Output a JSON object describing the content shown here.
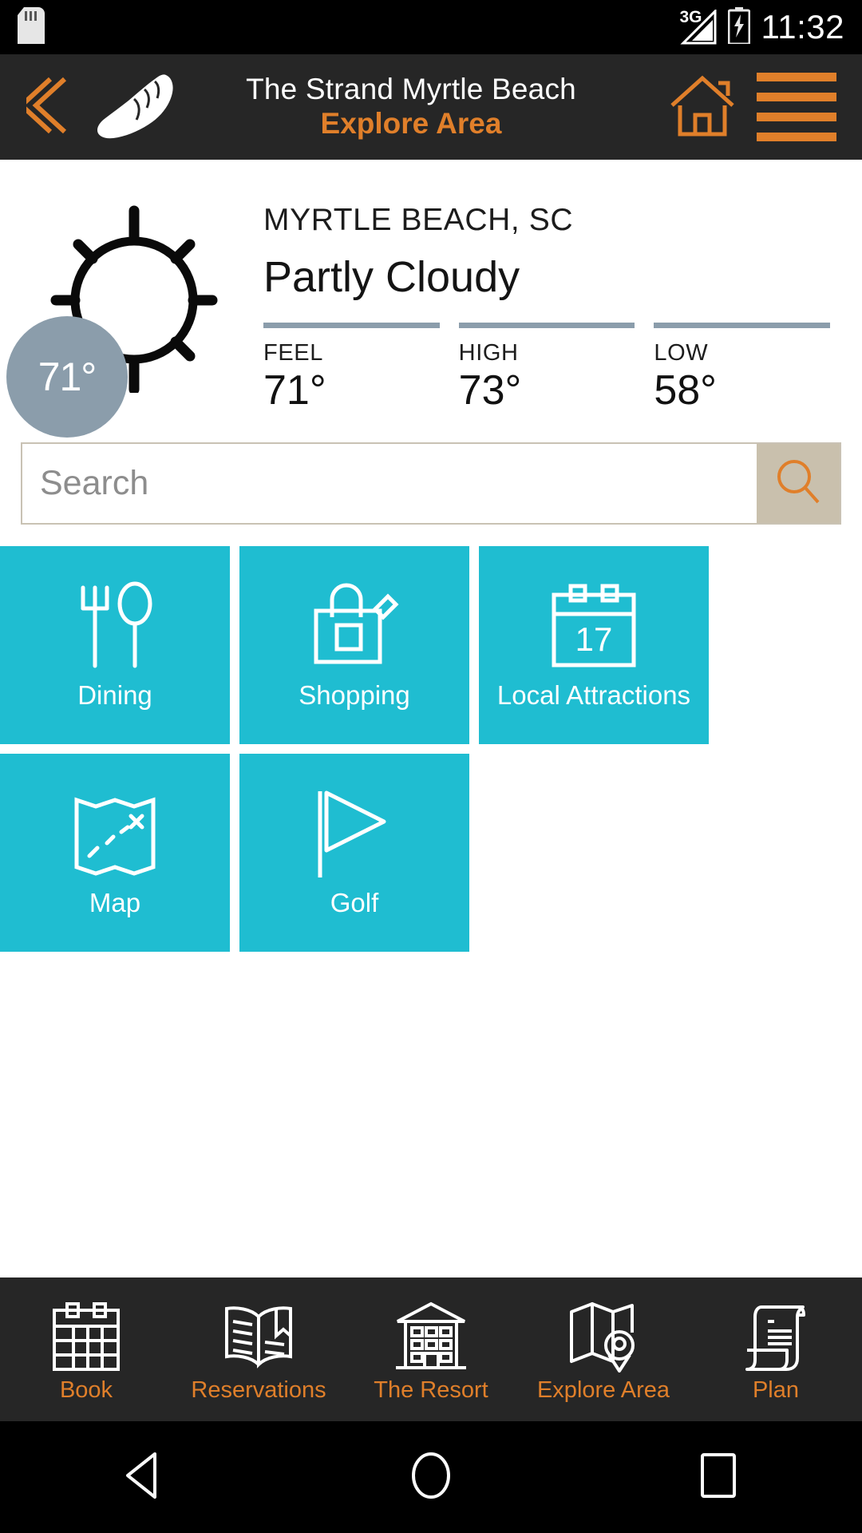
{
  "status_bar": {
    "sd_card_icon": "sd-card-icon",
    "network_label": "3G",
    "signal_icon": "signal-bars-icon",
    "battery_icon": "battery-charging-icon",
    "clock": "11:32"
  },
  "app_header": {
    "back_icon": "back-chevron-icon",
    "logo_icon": "seashell-logo-icon",
    "title": "The Strand Myrtle Beach",
    "subtitle": "Explore Area",
    "home_icon": "home-icon",
    "menu_icon": "hamburger-menu-icon",
    "accent_color": "#e07f2a",
    "background_color": "#262626"
  },
  "weather": {
    "condition_icon": "sun-icon",
    "current_temp": "71°",
    "bubble_color": "#8b9dab",
    "city": "MYRTLE BEACH, SC",
    "condition": "Partly Cloudy",
    "stats": [
      {
        "label": "FEEL",
        "value": "71°"
      },
      {
        "label": "HIGH",
        "value": "73°"
      },
      {
        "label": "LOW",
        "value": "58°"
      }
    ]
  },
  "search": {
    "placeholder": "Search",
    "value": "",
    "button_icon": "search-icon",
    "button_color": "#c9c0ad"
  },
  "tiles": {
    "color": "#1fbdd1",
    "items": [
      {
        "label": "Dining",
        "icon": "fork-and-spoon-icon"
      },
      {
        "label": "Shopping",
        "icon": "shopping-bag-icon"
      },
      {
        "label": "Local Attractions",
        "icon": "calendar-17-icon",
        "badge": "17"
      },
      {
        "label": "Map",
        "icon": "treasure-map-icon"
      },
      {
        "label": "Golf",
        "icon": "golf-flag-icon"
      }
    ]
  },
  "bottom_nav": {
    "accent_color": "#e07f2a",
    "items": [
      {
        "label": "Book",
        "icon": "calendar-icon"
      },
      {
        "label": "Reservations",
        "icon": "open-book-icon"
      },
      {
        "label": "The Resort",
        "icon": "building-icon"
      },
      {
        "label": "Explore Area",
        "icon": "map-pin-icon"
      },
      {
        "label": "Plan",
        "icon": "scroll-document-icon"
      }
    ]
  },
  "android_nav": {
    "back_icon": "android-back-icon",
    "home_icon": "android-home-icon",
    "recents_icon": "android-recents-icon"
  }
}
